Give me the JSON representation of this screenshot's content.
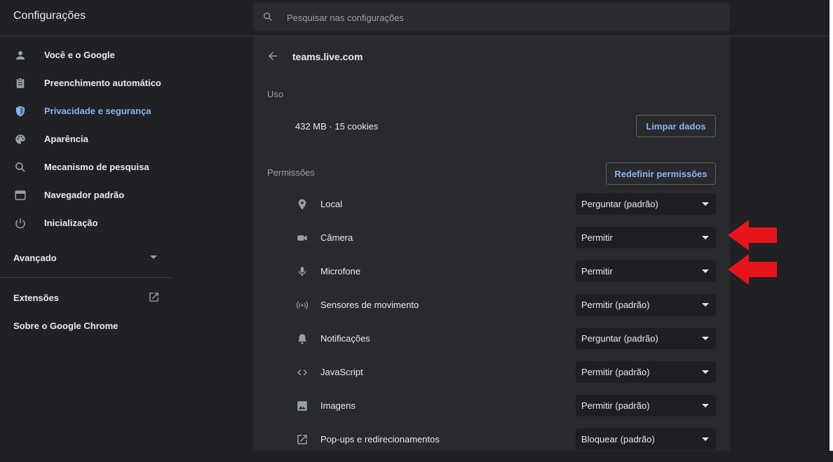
{
  "header": {
    "title": "Configurações",
    "search_placeholder": "Pesquisar nas configurações"
  },
  "sidebar": {
    "items": [
      {
        "label": "Você e o Google",
        "icon": "person-icon"
      },
      {
        "label": "Preenchimento automático",
        "icon": "clipboard-icon"
      },
      {
        "label": "Privacidade e segurança",
        "icon": "shield-icon",
        "active": true
      },
      {
        "label": "Aparência",
        "icon": "palette-icon"
      },
      {
        "label": "Mecanismo de pesquisa",
        "icon": "search-icon"
      },
      {
        "label": "Navegador padrão",
        "icon": "browser-window-icon"
      },
      {
        "label": "Inicialização",
        "icon": "power-icon"
      }
    ],
    "advanced": "Avançado",
    "extensions": "Extensões",
    "about": "Sobre o Google Chrome"
  },
  "site": {
    "name": "teams.live.com",
    "usage_heading": "Uso",
    "usage_text": "432 MB · 15 cookies",
    "clear_button": "Limpar dados",
    "permissions_heading": "Permissões",
    "reset_button": "Redefinir permissões"
  },
  "permissions": [
    {
      "label": "Local",
      "value": "Perguntar (padrão)",
      "icon": "location-pin-icon"
    },
    {
      "label": "Câmera",
      "value": "Permitir",
      "icon": "camera-icon"
    },
    {
      "label": "Microfone",
      "value": "Permitir",
      "icon": "microphone-icon"
    },
    {
      "label": "Sensores de movimento",
      "value": "Permitir (padrão)",
      "icon": "motion-sensor-icon"
    },
    {
      "label": "Notificações",
      "value": "Perguntar (padrão)",
      "icon": "bell-icon"
    },
    {
      "label": "JavaScript",
      "value": "Permitir (padrão)",
      "icon": "code-icon"
    },
    {
      "label": "Imagens",
      "value": "Permitir (padrão)",
      "icon": "image-icon"
    },
    {
      "label": "Pop-ups e redirecionamentos",
      "value": "Bloquear (padrão)",
      "icon": "popup-icon"
    }
  ],
  "colors": {
    "accent": "#8ab4f8",
    "annotation_arrow": "#e8141c",
    "background": "#202124",
    "panel": "#292a2d"
  }
}
